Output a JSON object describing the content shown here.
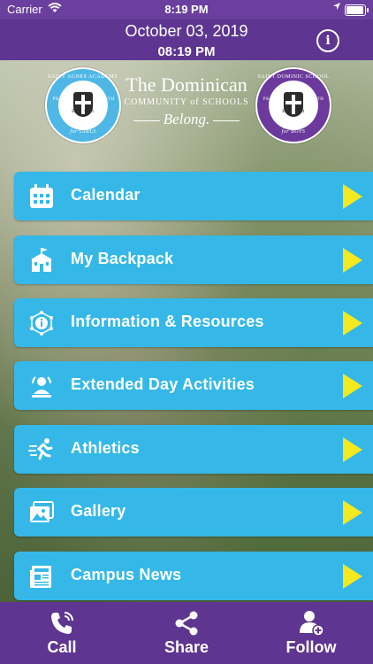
{
  "status_bar": {
    "carrier": "Carrier",
    "time": "8:19 PM",
    "battery_level": 1.0
  },
  "header": {
    "date": "October 03, 2019",
    "time": "08:19 PM",
    "info_icon": "info-icon"
  },
  "logos": {
    "left": {
      "top_text": "SAINT AGNES ACADEMY",
      "bottom_text": "for GIRLS",
      "est": "EST. 1851",
      "left_grade": "PK2",
      "right_grade": "12TH"
    },
    "center": {
      "line1": "The Dominican",
      "line2": "COMMUNITY of SCHOOLS",
      "line3": "Belong."
    },
    "right": {
      "top_text": "SAINT DOMINIC SCHOOL",
      "bottom_text": "for BOYS",
      "est": "EST. 1954",
      "left_grade": "PK2",
      "right_grade": "8TH"
    }
  },
  "menu": {
    "items": [
      {
        "label": "Calendar",
        "icon": "calendar-icon"
      },
      {
        "label": "My Backpack",
        "icon": "school-icon"
      },
      {
        "label": "Information & Resources",
        "icon": "info-network-icon"
      },
      {
        "label": "Extended Day Activities",
        "icon": "person-activity-icon"
      },
      {
        "label": "Athletics",
        "icon": "runner-icon"
      },
      {
        "label": "Gallery",
        "icon": "gallery-icon"
      },
      {
        "label": "Campus News",
        "icon": "newspaper-icon"
      }
    ]
  },
  "tabbar": {
    "tabs": [
      {
        "label": "Call",
        "icon": "phone-icon"
      },
      {
        "label": "Share",
        "icon": "share-icon"
      },
      {
        "label": "Follow",
        "icon": "follow-user-icon"
      }
    ]
  },
  "colors": {
    "purple": "#5e3590",
    "button_blue": "#35b8e8",
    "arrow_yellow": "#f4e81e"
  }
}
